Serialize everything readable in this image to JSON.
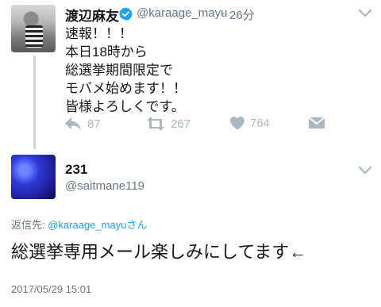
{
  "parent_tweet": {
    "display_name": "渡辺麻友",
    "handle": "@karaage_mayu",
    "time": "26分",
    "separator": "·",
    "verified": true,
    "text_lines": [
      "速報！！！",
      "本日18時から",
      "総選挙期間限定で",
      "モバメ始めます！！",
      "皆様よろしくです。"
    ],
    "actions": {
      "reply_count": "87",
      "retweet_count": "267",
      "like_count": "764",
      "icons": [
        "reply-icon",
        "retweet-icon",
        "like-icon",
        "direct-message-icon"
      ]
    }
  },
  "reply_tweet": {
    "display_name": "231",
    "handle": "@saitmane119",
    "reply_prefix": "返信先: ",
    "reply_mention": "@karaage_mayu",
    "reply_suffix": "さん",
    "text": "総選挙専用メール楽しみにしてます←",
    "timestamp": "2017/05/29 15:01"
  },
  "colors": {
    "verified_blue": "#1da1f2",
    "muted": "#aab8c2",
    "secondary_text": "#657786",
    "mention": "#1da1f2"
  }
}
